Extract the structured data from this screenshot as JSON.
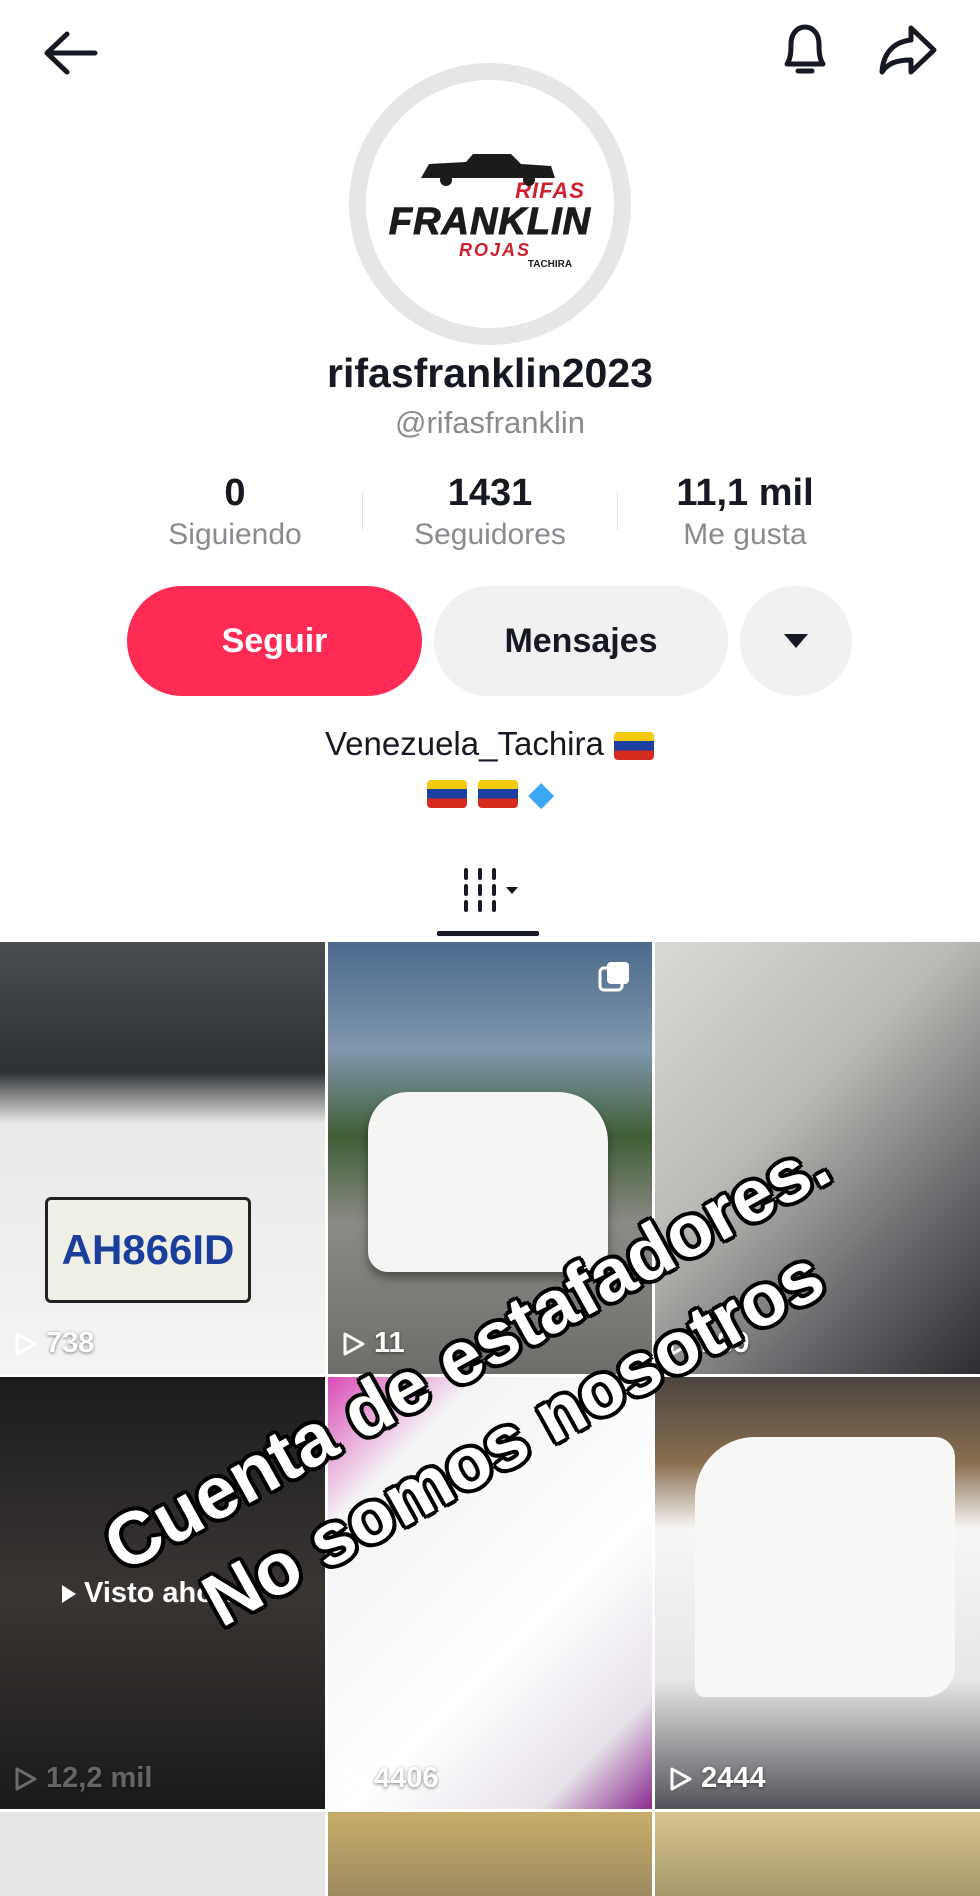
{
  "profile": {
    "username": "rifasfranklin2023",
    "handle": "@rifasfranklin",
    "avatar_logo": {
      "top": "RIFAS",
      "main": "FRANKLIN",
      "sub": "ROJAS",
      "small": "TACHIRA"
    }
  },
  "stats": [
    {
      "value": "0",
      "label": "Siguiendo"
    },
    {
      "value": "1431",
      "label": "Seguidores"
    },
    {
      "value": "11,1 mil",
      "label": "Me gusta"
    }
  ],
  "actions": {
    "follow": "Seguir",
    "messages": "Mensajes"
  },
  "bio": {
    "line1": "Venezuela_Tachira",
    "line2_emoji": "flag flag gem"
  },
  "videos": [
    {
      "views": "738",
      "plate": "AH866ID"
    },
    {
      "views": "11"
    },
    {
      "views": "189"
    },
    {
      "views": "12,2 mil",
      "badge": "Visto ahora"
    },
    {
      "views": "4406"
    },
    {
      "views": "2444"
    }
  ],
  "overlay_text": {
    "line1": "Cuenta de estafadores.",
    "line2": "No somos nosotros"
  },
  "colors": {
    "follow": "#fe2c55",
    "secondary_button": "#f1f1f2",
    "muted_text": "#8a8b91"
  },
  "icons": [
    "back-arrow-icon",
    "bell-icon",
    "share-icon",
    "dropdown-triangle-icon",
    "grid-tab-icon",
    "play-icon",
    "multi-photo-icon"
  ]
}
